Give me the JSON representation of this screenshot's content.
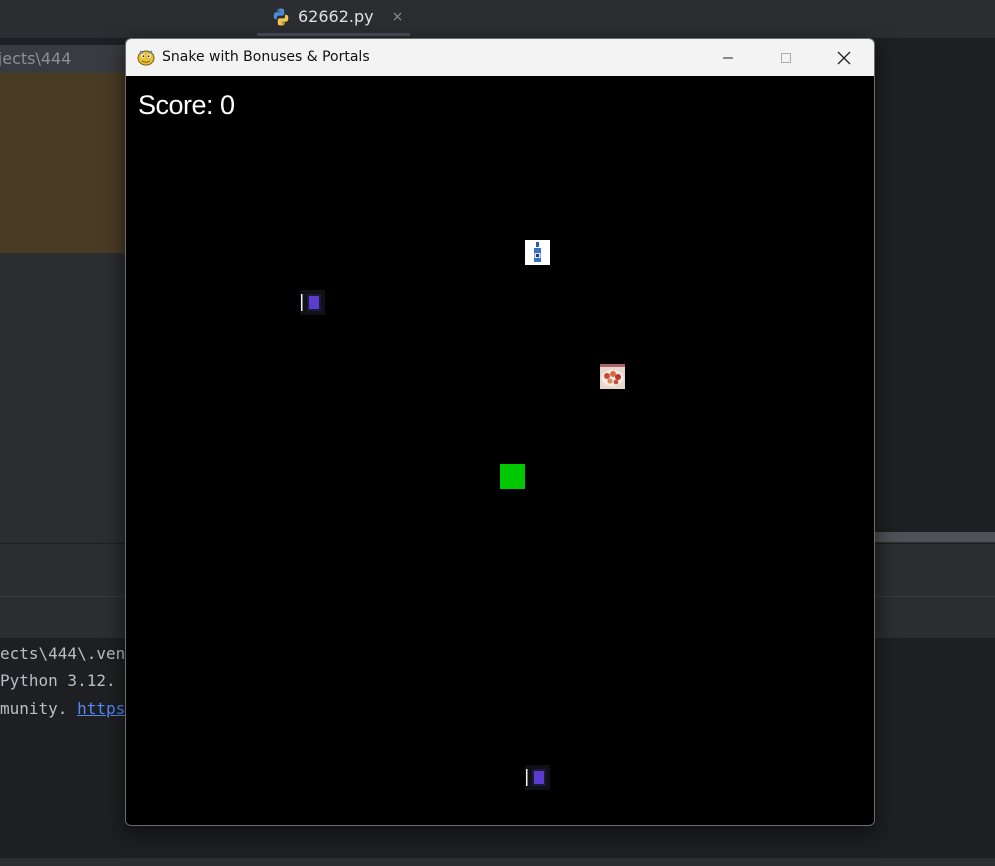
{
  "ide": {
    "tab": {
      "filename": "62662.py",
      "close_glyph": "×",
      "icon": "python-icon"
    },
    "project_path": "ojects\\444",
    "terminal": {
      "line1": "ects\\444\\.ven",
      "line2": " Python 3.12.",
      "line3_text": "munity. ",
      "line3_link": "https"
    }
  },
  "window": {
    "title": "Snake with Bonuses & Portals",
    "icon": "pygame-snake-icon",
    "controls": [
      "minimize",
      "maximize",
      "close"
    ]
  },
  "game": {
    "score_label": "Score: 0",
    "score": 0,
    "colors": {
      "background": "#000000",
      "snake": "#00c800",
      "portal": "#5a3ccf",
      "score_text": "#ffffff"
    },
    "snake": {
      "segments": 1
    },
    "portals": [
      {
        "name": "portal-a",
        "icon": "portal-icon"
      },
      {
        "name": "portal-b",
        "icon": "portal-icon"
      }
    ],
    "bonuses": [
      {
        "name": "bottle-bonus",
        "icon": "bottle-icon"
      },
      {
        "name": "food-bonus",
        "icon": "food-plate-icon"
      }
    ]
  }
}
